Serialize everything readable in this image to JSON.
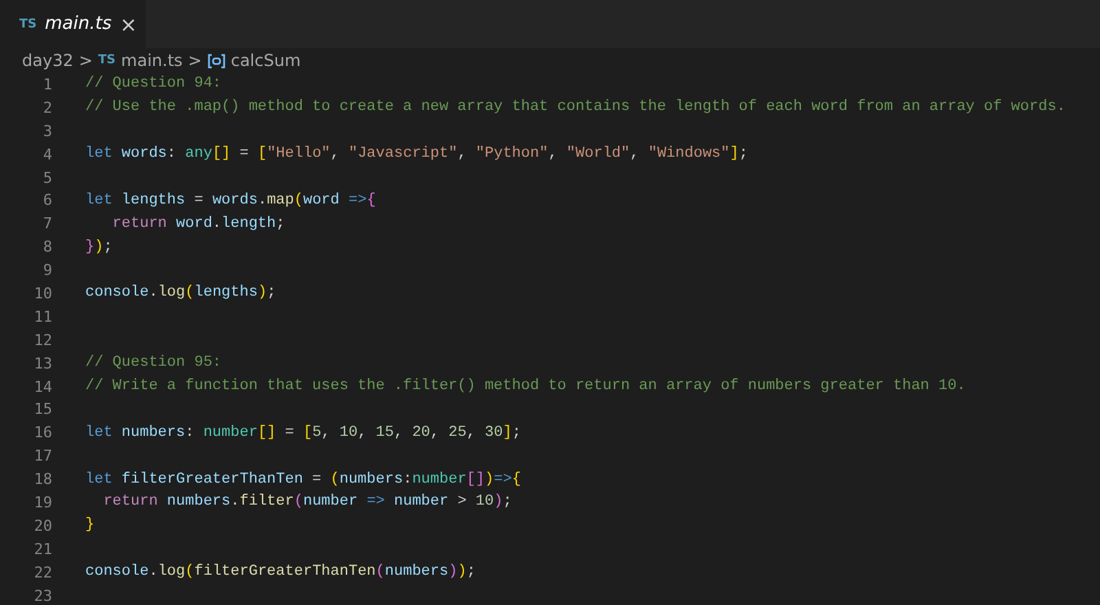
{
  "tabs": [
    {
      "icon_text": "TS",
      "label": "main.ts",
      "close": "×",
      "selected": true,
      "preview": true
    }
  ],
  "breadcrumb": [
    {
      "kind": "folder",
      "text": "day32"
    },
    {
      "kind": "file",
      "icon_text": "TS",
      "text": "main.ts"
    },
    {
      "kind": "symbol",
      "text": "calcSum"
    }
  ],
  "breadcrumb_separators": [
    ">",
    ">"
  ],
  "lines": [
    {
      "number": "1",
      "tokens": [
        {
          "kind": "comment",
          "text": "// Question 94:"
        }
      ]
    },
    {
      "number": "2",
      "tokens": [
        {
          "kind": "comment",
          "text": "// Use the .map() method to create a new array that contains the length of each word from an array of words."
        }
      ]
    },
    {
      "number": "3"
    },
    {
      "number": "4",
      "tokens": [
        {
          "kind": "keyword",
          "text": "let "
        },
        {
          "kind": "variable",
          "text": "words"
        },
        {
          "kind": "plain",
          "text": ": "
        },
        {
          "kind": "type",
          "text": "any"
        },
        {
          "kind": "bracket1",
          "text": "[]"
        },
        {
          "kind": "plain",
          "text": " = "
        },
        {
          "kind": "bracket1",
          "text": "["
        },
        {
          "kind": "string",
          "text": "\"Hello\""
        },
        {
          "kind": "plain",
          "text": ", "
        },
        {
          "kind": "string",
          "text": "\"Javascript\""
        },
        {
          "kind": "plain",
          "text": ", "
        },
        {
          "kind": "string",
          "text": "\"Python\""
        },
        {
          "kind": "plain",
          "text": ", "
        },
        {
          "kind": "string",
          "text": "\"World\""
        },
        {
          "kind": "plain",
          "text": ", "
        },
        {
          "kind": "string",
          "text": "\"Windows\""
        },
        {
          "kind": "bracket1",
          "text": "]"
        },
        {
          "kind": "plain",
          "text": ";"
        }
      ]
    },
    {
      "number": "5"
    },
    {
      "number": "6",
      "tokens": [
        {
          "kind": "keyword",
          "text": "let "
        },
        {
          "kind": "variable",
          "text": "lengths"
        },
        {
          "kind": "plain",
          "text": " = "
        },
        {
          "kind": "variable",
          "text": "words"
        },
        {
          "kind": "plain",
          "text": "."
        },
        {
          "kind": "function",
          "text": "map"
        },
        {
          "kind": "bracket1",
          "text": "("
        },
        {
          "kind": "variable",
          "text": "word "
        },
        {
          "kind": "keyword",
          "text": "=>"
        },
        {
          "kind": "bracket2",
          "text": "{"
        }
      ]
    },
    {
      "number": "7",
      "tokens": [
        {
          "kind": "control",
          "text": "   return "
        },
        {
          "kind": "variable",
          "text": "word"
        },
        {
          "kind": "plain",
          "text": "."
        },
        {
          "kind": "variable",
          "text": "length"
        },
        {
          "kind": "plain",
          "text": ";"
        }
      ]
    },
    {
      "number": "8",
      "tokens": [
        {
          "kind": "bracket2",
          "text": "}"
        },
        {
          "kind": "bracket1",
          "text": ")"
        },
        {
          "kind": "plain",
          "text": ";"
        }
      ]
    },
    {
      "number": "9"
    },
    {
      "number": "10",
      "tokens": [
        {
          "kind": "variable",
          "text": "console"
        },
        {
          "kind": "plain",
          "text": "."
        },
        {
          "kind": "function",
          "text": "log"
        },
        {
          "kind": "bracket1",
          "text": "("
        },
        {
          "kind": "variable",
          "text": "lengths"
        },
        {
          "kind": "bracket1",
          "text": ")"
        },
        {
          "kind": "plain",
          "text": ";"
        }
      ]
    },
    {
      "number": "11"
    },
    {
      "number": "12"
    },
    {
      "number": "13",
      "tokens": [
        {
          "kind": "comment",
          "text": "// Question 95:"
        }
      ]
    },
    {
      "number": "14",
      "tokens": [
        {
          "kind": "comment",
          "text": "// Write a function that uses the .filter() method to return an array of numbers greater than 10."
        }
      ]
    },
    {
      "number": "15"
    },
    {
      "number": "16",
      "tokens": [
        {
          "kind": "keyword",
          "text": "let "
        },
        {
          "kind": "variable",
          "text": "numbers"
        },
        {
          "kind": "plain",
          "text": ": "
        },
        {
          "kind": "type",
          "text": "number"
        },
        {
          "kind": "bracket1",
          "text": "[]"
        },
        {
          "kind": "plain",
          "text": " = "
        },
        {
          "kind": "bracket1",
          "text": "["
        },
        {
          "kind": "number",
          "text": "5"
        },
        {
          "kind": "plain",
          "text": ", "
        },
        {
          "kind": "number",
          "text": "10"
        },
        {
          "kind": "plain",
          "text": ", "
        },
        {
          "kind": "number",
          "text": "15"
        },
        {
          "kind": "plain",
          "text": ", "
        },
        {
          "kind": "number",
          "text": "20"
        },
        {
          "kind": "plain",
          "text": ", "
        },
        {
          "kind": "number",
          "text": "25"
        },
        {
          "kind": "plain",
          "text": ", "
        },
        {
          "kind": "number",
          "text": "30"
        },
        {
          "kind": "bracket1",
          "text": "]"
        },
        {
          "kind": "plain",
          "text": ";"
        }
      ]
    },
    {
      "number": "17"
    },
    {
      "number": "18",
      "tokens": [
        {
          "kind": "keyword",
          "text": "let "
        },
        {
          "kind": "variable",
          "text": "filterGreaterThanTen"
        },
        {
          "kind": "plain",
          "text": " = "
        },
        {
          "kind": "bracket1",
          "text": "("
        },
        {
          "kind": "variable",
          "text": "numbers"
        },
        {
          "kind": "plain",
          "text": ":"
        },
        {
          "kind": "type",
          "text": "number"
        },
        {
          "kind": "bracket2",
          "text": "[]"
        },
        {
          "kind": "bracket1",
          "text": ")"
        },
        {
          "kind": "keyword",
          "text": "=>"
        },
        {
          "kind": "bracket1",
          "text": "{"
        }
      ]
    },
    {
      "number": "19",
      "tokens": [
        {
          "kind": "control",
          "text": "  return "
        },
        {
          "kind": "variable",
          "text": "numbers"
        },
        {
          "kind": "plain",
          "text": "."
        },
        {
          "kind": "function",
          "text": "filter"
        },
        {
          "kind": "bracket2",
          "text": "("
        },
        {
          "kind": "variable",
          "text": "number "
        },
        {
          "kind": "keyword",
          "text": "=> "
        },
        {
          "kind": "variable",
          "text": "number"
        },
        {
          "kind": "plain",
          "text": " > "
        },
        {
          "kind": "number",
          "text": "10"
        },
        {
          "kind": "bracket2",
          "text": ")"
        },
        {
          "kind": "plain",
          "text": ";"
        }
      ]
    },
    {
      "number": "20",
      "tokens": [
        {
          "kind": "bracket1",
          "text": "}"
        }
      ]
    },
    {
      "number": "21"
    },
    {
      "number": "22",
      "tokens": [
        {
          "kind": "variable",
          "text": "console"
        },
        {
          "kind": "plain",
          "text": "."
        },
        {
          "kind": "function",
          "text": "log"
        },
        {
          "kind": "bracket1",
          "text": "("
        },
        {
          "kind": "function",
          "text": "filterGreaterThanTen"
        },
        {
          "kind": "bracket2",
          "text": "("
        },
        {
          "kind": "variable",
          "text": "numbers"
        },
        {
          "kind": "bracket2",
          "text": ")"
        },
        {
          "kind": "bracket1",
          "text": ")"
        },
        {
          "kind": "plain",
          "text": ";"
        }
      ]
    },
    {
      "number": "23"
    }
  ]
}
